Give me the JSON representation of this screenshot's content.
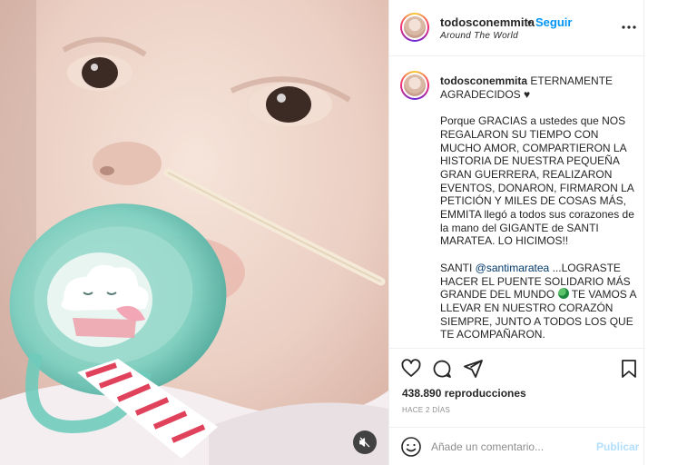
{
  "post": {
    "username": "todosconemmita",
    "separator": "•",
    "follow_label": "Seguir",
    "location": "Around The World",
    "more_icon": "more-horizontal-icon"
  },
  "caption": {
    "username": "todosconemmita",
    "line1": "ETERNAMENTE AGRADECIDOS ♥",
    "paragraph2": "Porque GRACIAS a ustedes que NOS REGALARON SU TIEMPO CON MUCHO AMOR, COMPARTIERON LA HISTORIA DE NUESTRA PEQUEÑA GRAN GUERRERA, REALIZARON EVENTOS, DONARON, FIRMARON LA PETICIÓN Y MILES DE COSAS MÁS, EMMITA llegó a todos sus corazones de la mano del GIGANTE de SANTI MARATEA. LO HICIMOS!!",
    "p3_before": "SANTI ",
    "p3_mention": "@santimaratea",
    "p3_middle": " ...LOGRASTE HACER EL PUENTE SOLIDARIO MÁS GRANDE DEL MUNDO ",
    "p3_after": " TE VAMOS A LLEVAR EN NUESTRO CORAZÓN SIEMPRE, JUNTO A TODOS LOS QUE TE ACOMPAÑARON."
  },
  "stats": {
    "views": "438.890 reproducciones",
    "time": "HACE 2 DÍAS"
  },
  "comment": {
    "placeholder": "Añade un comentario...",
    "publish_label": "Publicar"
  },
  "icons": [
    "heart-icon",
    "comment-icon",
    "share-icon",
    "bookmark-icon",
    "emoji-icon",
    "mute-icon",
    "globe-emoji-icon"
  ]
}
